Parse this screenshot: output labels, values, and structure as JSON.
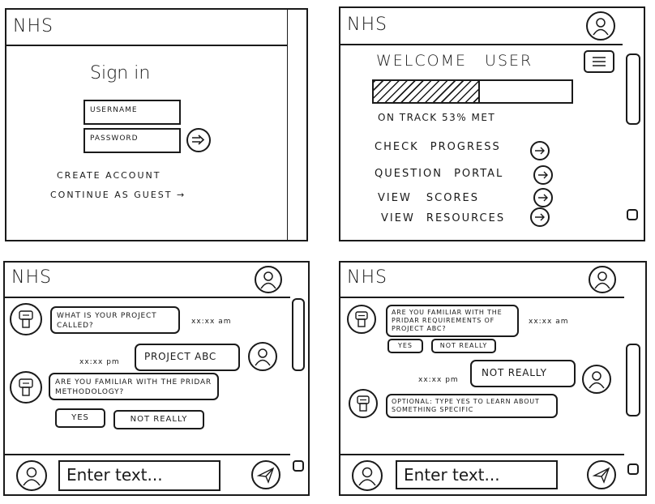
{
  "login": {
    "app_name": "NHS",
    "title": "Sign in",
    "username_placeholder": "USERNAME",
    "password_placeholder": "PASSWORD",
    "create_account": "CREATE ACCOUNT",
    "continue_guest": "CONTINUE AS GUEST →"
  },
  "dashboard": {
    "app_name": "NHS",
    "welcome": "WELCOME USER",
    "progress_fraction": 0.53,
    "progress_text": "ON TRACK 53% MET",
    "menu": [
      {
        "label": "CHECK PROGRESS"
      },
      {
        "label": "QUESTION PORTAL"
      },
      {
        "label": "VIEW SCORES"
      },
      {
        "label": "VIEW RESOURCES"
      }
    ]
  },
  "chat1": {
    "app_name": "NHS",
    "bot_msg_1": "WHAT IS YOUR PROJECT CALLED?",
    "time_1": "xx:xx am",
    "time_2": "xx:xx pm",
    "user_msg_1": "PROJECT ABC",
    "bot_msg_2": "ARE YOU FAMILIAR WITH THE PRIDAR METHODOLOGY?",
    "option_yes": "YES",
    "option_no": "NOT REALLY",
    "input_placeholder": "Enter text..."
  },
  "chat2": {
    "app_name": "NHS",
    "bot_msg_1": "ARE YOU FAMILIAR WITH THE PRIDAR REQUIREMENTS OF PROJECT ABC?",
    "time_1": "xx:xx am",
    "option_yes": "YES",
    "option_no": "NOT REALLY",
    "time_2": "xx:xx pm",
    "user_msg_1": "NOT REALLY",
    "bot_msg_2": "OPTIONAL: TYPE YES TO LEARN ABOUT SOMETHING SPECIFIC",
    "input_placeholder": "Enter text..."
  }
}
